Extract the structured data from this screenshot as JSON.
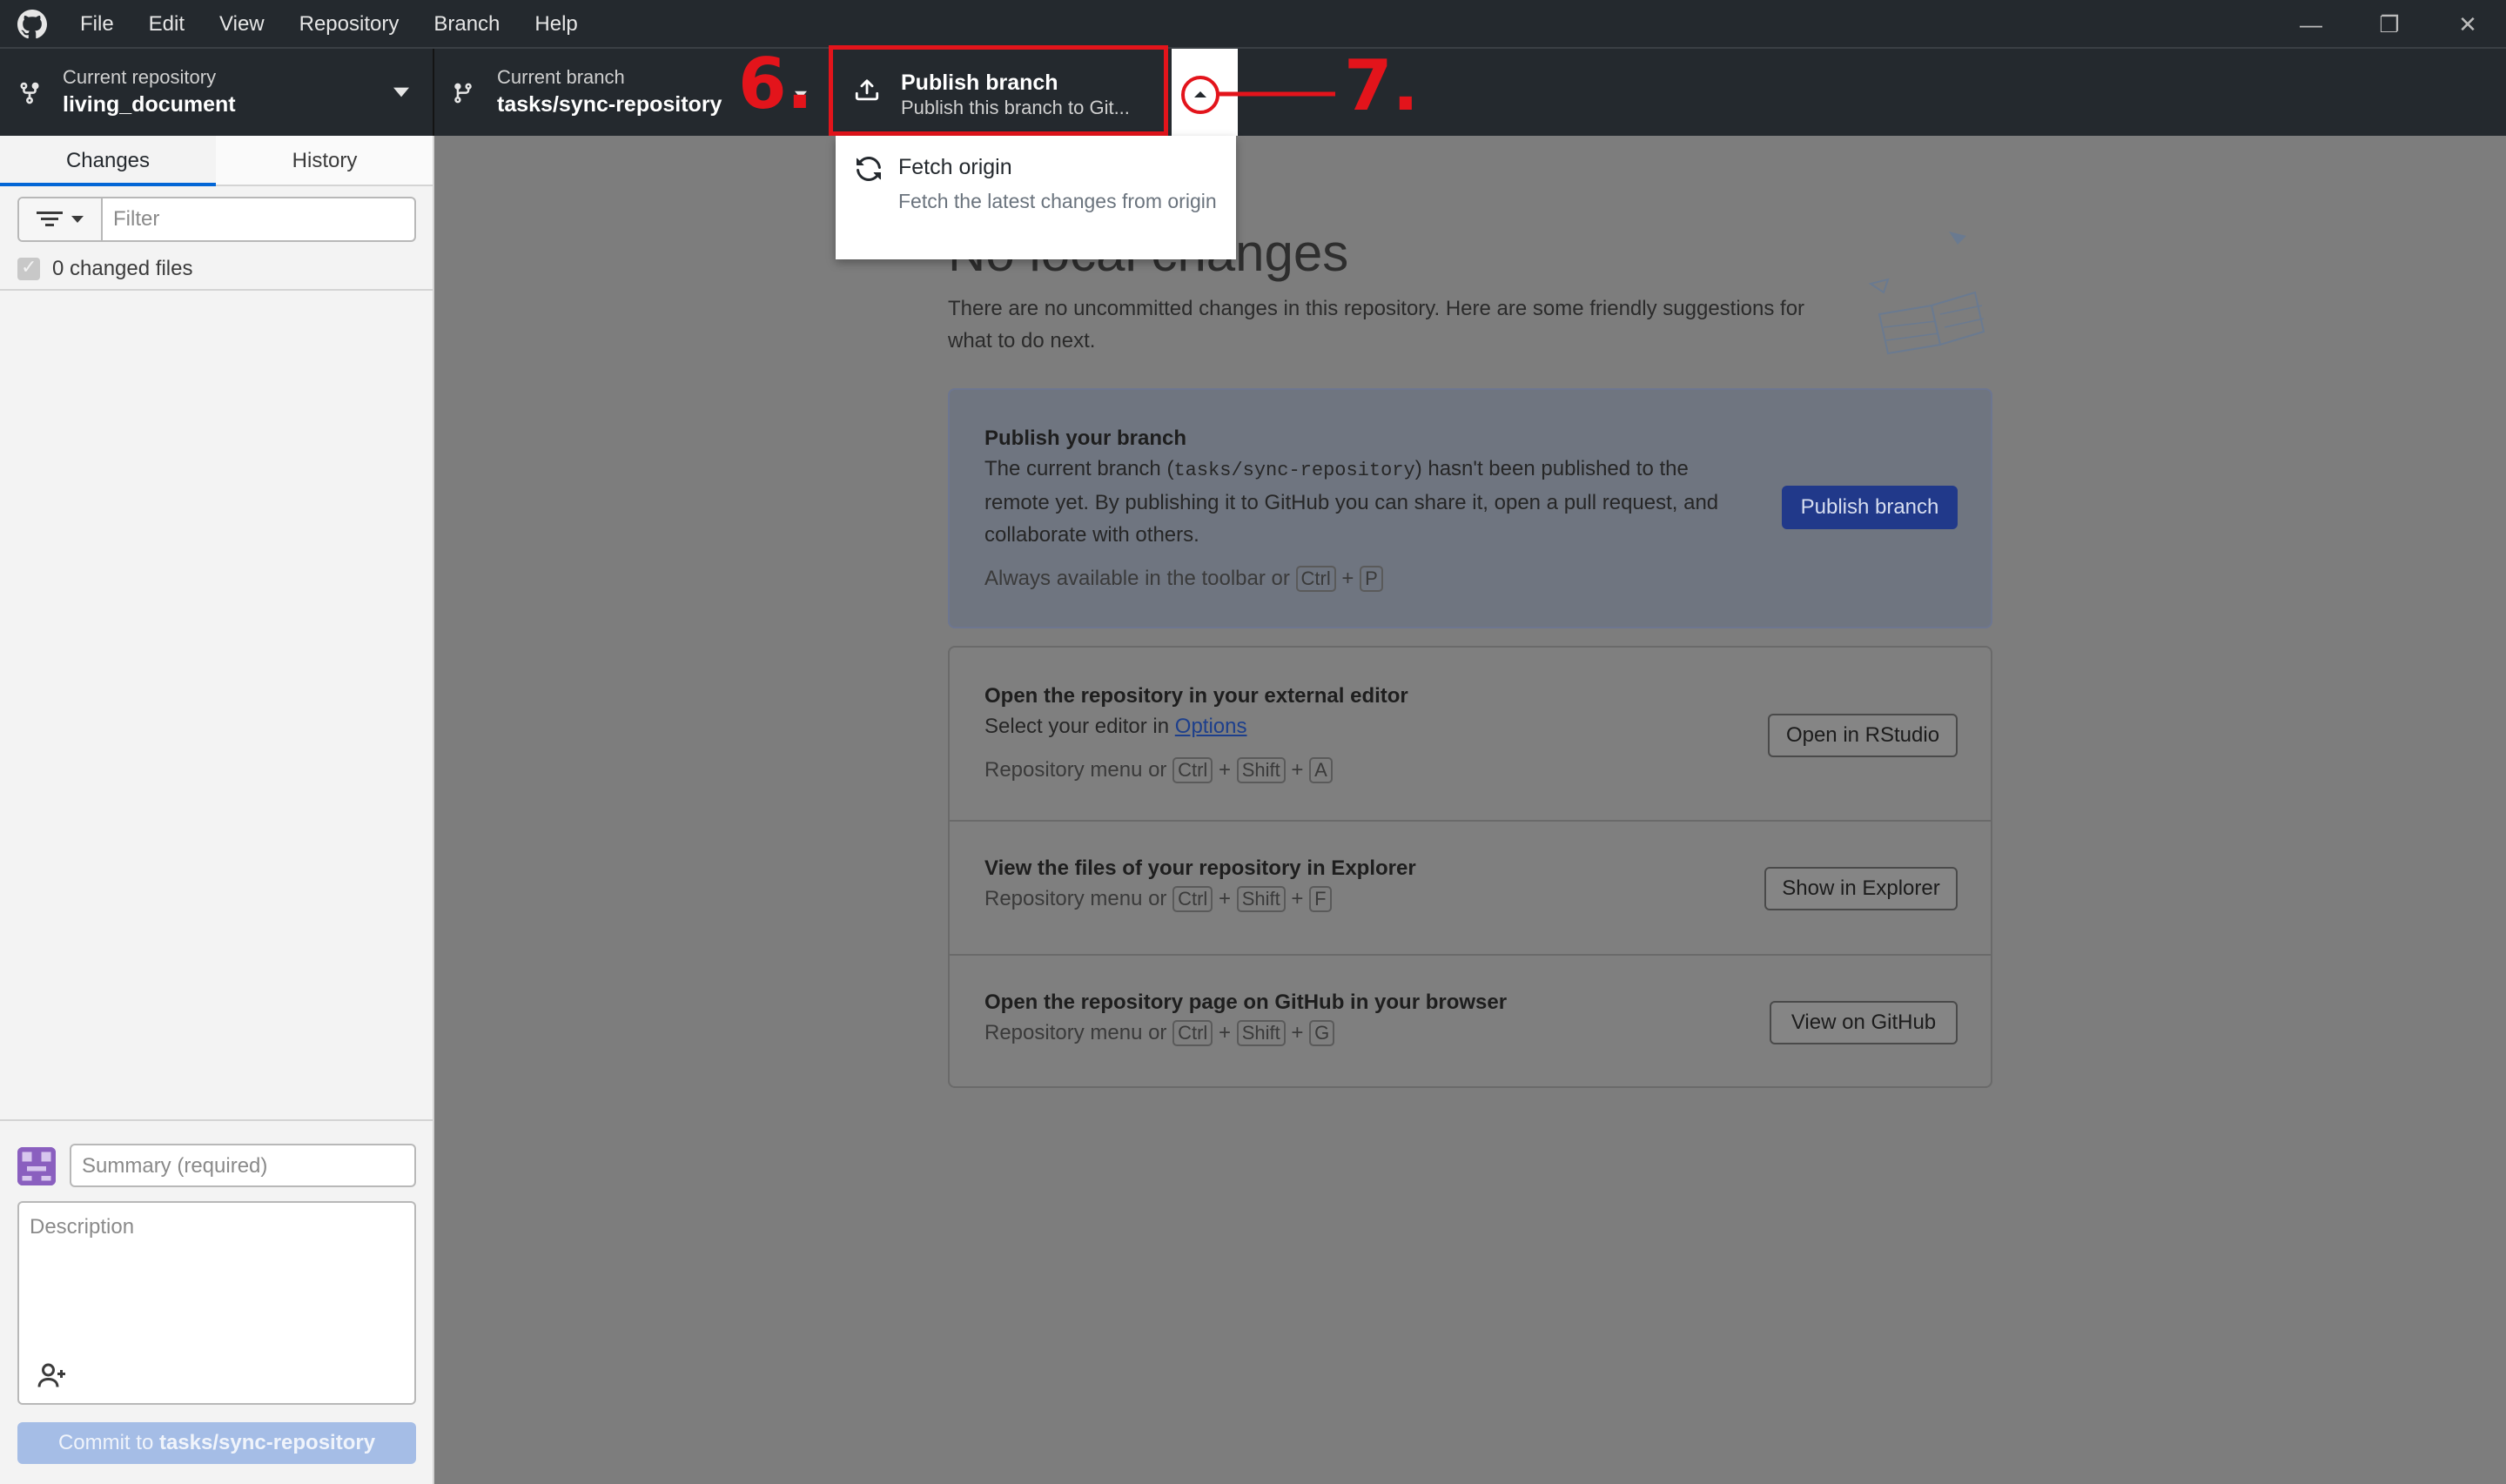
{
  "menu": [
    "File",
    "Edit",
    "View",
    "Repository",
    "Branch",
    "Help"
  ],
  "window_controls": {
    "minimize": "—",
    "restore": "❐",
    "close": "✕"
  },
  "toolbar": {
    "repo_label": "Current repository",
    "repo_value": "living_document",
    "branch_label": "Current branch",
    "branch_value": "tasks/sync-repository",
    "publish_title": "Publish branch",
    "publish_sub": "Publish this branch to Git..."
  },
  "dropdown": {
    "title": "Fetch origin",
    "description": "Fetch the latest changes from origin"
  },
  "annotations": {
    "six": "6.",
    "seven": "7."
  },
  "sidebar": {
    "tabs": [
      "Changes",
      "History"
    ],
    "filter_placeholder": "Filter",
    "changed_files": "0 changed files",
    "summary_placeholder": "Summary (required)",
    "description_placeholder": "Description",
    "commit_prefix": "Commit to ",
    "commit_branch": "tasks/sync-repository"
  },
  "main": {
    "headline": "No local changes",
    "intro": "There are no uncommitted changes in this repository. Here are some friendly suggestions for what to do next.",
    "publish_card": {
      "title": "Publish your branch",
      "text_1": "The current branch (",
      "branch": "tasks/sync-repository",
      "text_2": ") hasn't been published to the remote yet. By publishing it to GitHub you can share it, open a pull request, and collaborate with others.",
      "hint": "Always available in the toolbar or",
      "key_1": "Ctrl",
      "key_2": "P",
      "button": "Publish branch"
    },
    "editor_card": {
      "title": "Open the repository in your external editor",
      "text": "Select your editor in",
      "link": "Options",
      "hint": "Repository menu or",
      "key_1": "Ctrl",
      "key_2": "Shift",
      "key_3": "A",
      "button": "Open in RStudio"
    },
    "explorer_card": {
      "title": "View the files of your repository in Explorer",
      "hint": "Repository menu or",
      "key_1": "Ctrl",
      "key_2": "Shift",
      "key_3": "F",
      "button": "Show in Explorer"
    },
    "github_card": {
      "title": "Open the repository page on GitHub in your browser",
      "hint": "Repository menu or",
      "key_1": "Ctrl",
      "key_2": "Shift",
      "key_3": "G",
      "button": "View on GitHub"
    }
  },
  "colors": {
    "accent": "#0366d6",
    "annotation": "#e3141b",
    "toolbar": "#24292e"
  }
}
